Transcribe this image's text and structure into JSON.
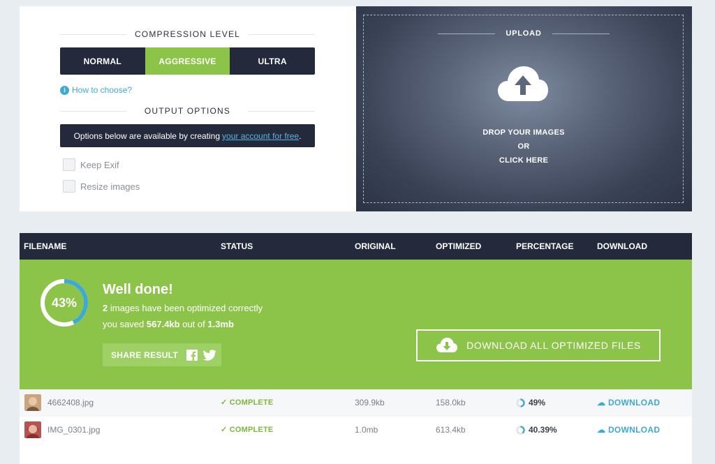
{
  "options": {
    "compression_title": "COMPRESSION LEVEL",
    "levels": [
      {
        "label": "NORMAL",
        "active": false
      },
      {
        "label": "AGGRESSIVE",
        "active": true
      },
      {
        "label": "ULTRA",
        "active": false
      }
    ],
    "how_to_choose": "How to choose?",
    "output_title": "OUTPUT OPTIONS",
    "notice_text": "Options below are available by creating",
    "notice_link": "your account for free",
    "notice_end": ".",
    "checkboxes": [
      {
        "label": "Keep Exif",
        "checked": false
      },
      {
        "label": "Resize images",
        "checked": false
      }
    ]
  },
  "upload": {
    "title": "UPLOAD",
    "line1": "DROP YOUR IMAGES",
    "line2": "OR",
    "line3": "CLICK HERE"
  },
  "table": {
    "headers": [
      "FILENAME",
      "STATUS",
      "ORIGINAL",
      "OPTIMIZED",
      "PERCENTAGE",
      "DOWNLOAD"
    ],
    "summary": {
      "percent": "43%",
      "percent_value": 43,
      "title": "Well done!",
      "count": "2",
      "count_text": "images have been optimized correctly",
      "saved_prefix": "you saved",
      "saved": "567.4kb",
      "saved_mid": "out of",
      "total": "1.3mb",
      "share_label": "SHARE RESULT",
      "download_all": "DOWNLOAD ALL OPTIMIZED FILES"
    },
    "rows": [
      {
        "filename": "4662408.jpg",
        "status": "COMPLETE",
        "original": "309.9kb",
        "optimized": "158.0kb",
        "percentage": "49%",
        "percent_value": 49,
        "download": "DOWNLOAD"
      },
      {
        "filename": "IMG_0301.jpg",
        "status": "COMPLETE",
        "original": "1.0mb",
        "optimized": "613.4kb",
        "percentage": "40.39%",
        "percent_value": 40.39,
        "download": "DOWNLOAD"
      }
    ]
  },
  "colors": {
    "accent_green": "#8cc449",
    "dark_navy": "#242a3b",
    "link_blue": "#3fa9d6",
    "ring_blue": "#3fa9d6"
  }
}
